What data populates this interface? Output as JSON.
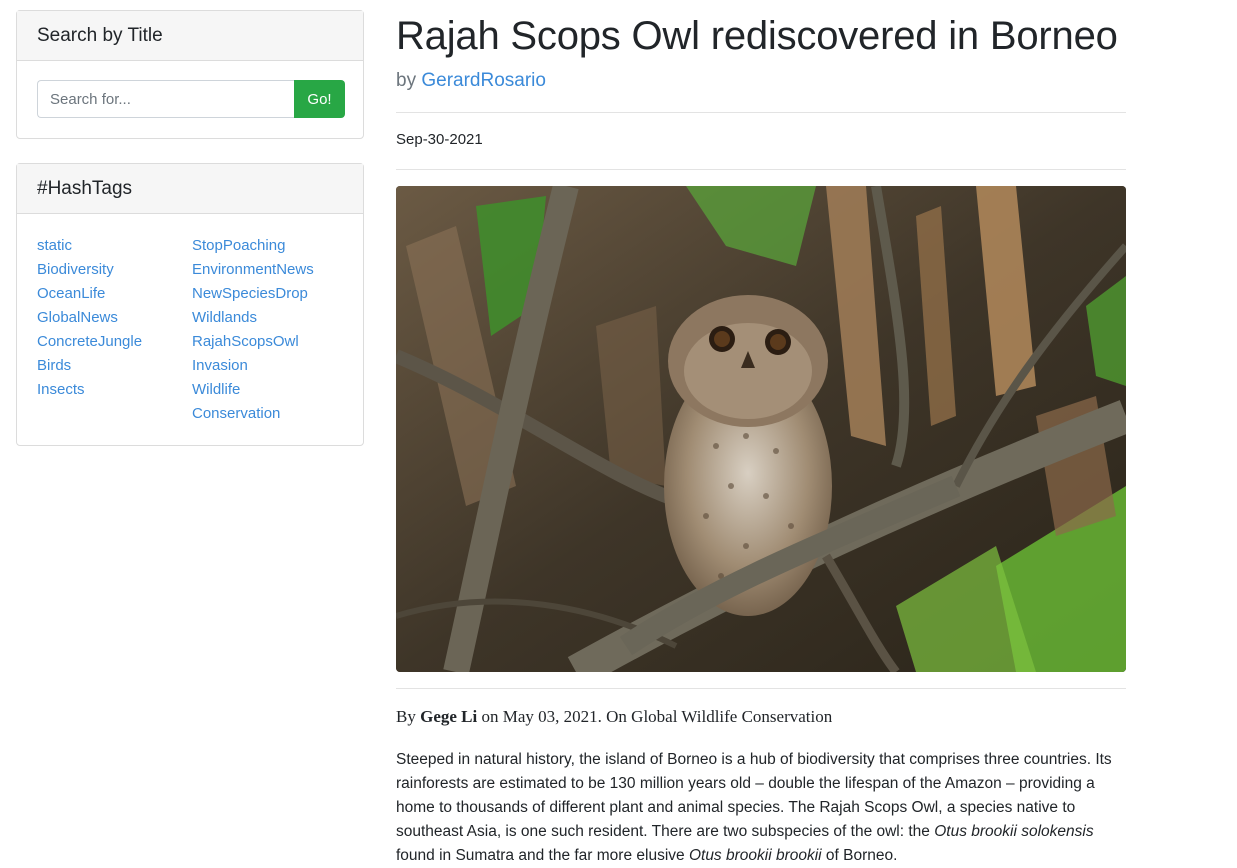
{
  "sidebar": {
    "search": {
      "title": "Search by Title",
      "placeholder": "Search for...",
      "button_label": "Go!"
    },
    "hashtags": {
      "title": "#HashTags",
      "left": [
        "static",
        "Biodiversity",
        "OceanLife",
        "GlobalNews",
        "ConcreteJungle",
        "Birds",
        "Insects"
      ],
      "right": [
        "StopPoaching",
        "EnvironmentNews",
        "NewSpeciesDrop",
        "Wildlands",
        "RajahScopsOwl",
        "Invasion",
        "Wildlife",
        "Conservation"
      ]
    }
  },
  "article": {
    "title": "Rajah Scops Owl rediscovered in Borneo",
    "by_prefix": "by",
    "author": "GerardRosario",
    "date": "Sep-30-2021",
    "credit": {
      "prefix": "By",
      "name": "Gege Li",
      "suffix": "on May 03, 2021. On Global Wildlife Conservation"
    },
    "paragraph": {
      "part1": "Steeped in natural history, the island of Borneo is a hub of biodiversity that comprises three countries. Its rainforests are estimated to be 130 million years old – double the lifespan of the Amazon – providing a home to thousands of different plant and animal species. The Rajah Scops Owl, a species native to southeast Asia, is one such resident. There are two subspecies of the owl: the ",
      "italic1": "Otus brookii solokensis",
      "part2": " found in Sumatra and the far more elusive ",
      "italic2": "Otus brookii brookii",
      "part3": " of Borneo."
    }
  },
  "colors": {
    "link": "#3b8ad9",
    "button_green": "#28a745",
    "card_header_bg": "#f6f6f6",
    "border": "#dcdcdc"
  }
}
